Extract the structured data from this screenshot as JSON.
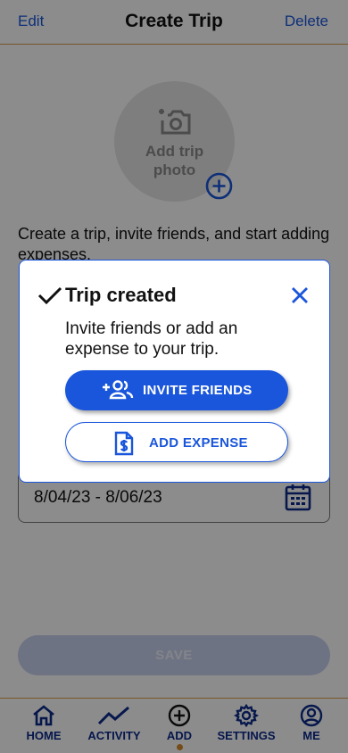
{
  "header": {
    "left_action": "Edit",
    "title": "Create Trip",
    "right_action": "Delete"
  },
  "photo": {
    "line1": "Add trip",
    "line2": "photo"
  },
  "intro_text": "Create a trip, invite friends, and start adding expenses.",
  "date_field": {
    "value": "8/04/23 - 8/06/23"
  },
  "save_label": "SAVE",
  "tabs": [
    {
      "label": "HOME",
      "icon": "home-icon"
    },
    {
      "label": "ACTIVITY",
      "icon": "activity-icon"
    },
    {
      "label": "ADD",
      "icon": "add-circle-icon",
      "active": true
    },
    {
      "label": "SETTINGS",
      "icon": "gear-icon"
    },
    {
      "label": "ME",
      "icon": "account-icon"
    }
  ],
  "modal": {
    "title": "Trip created",
    "message": "Invite friends or add an expense to your trip.",
    "primary_button": "INVITE FRIENDS",
    "secondary_button": "ADD EXPENSE"
  },
  "colors": {
    "accent": "#1a56db",
    "nav": "#0b2a8a",
    "divider": "#d89b4a",
    "active_dot": "#d48a2b"
  }
}
